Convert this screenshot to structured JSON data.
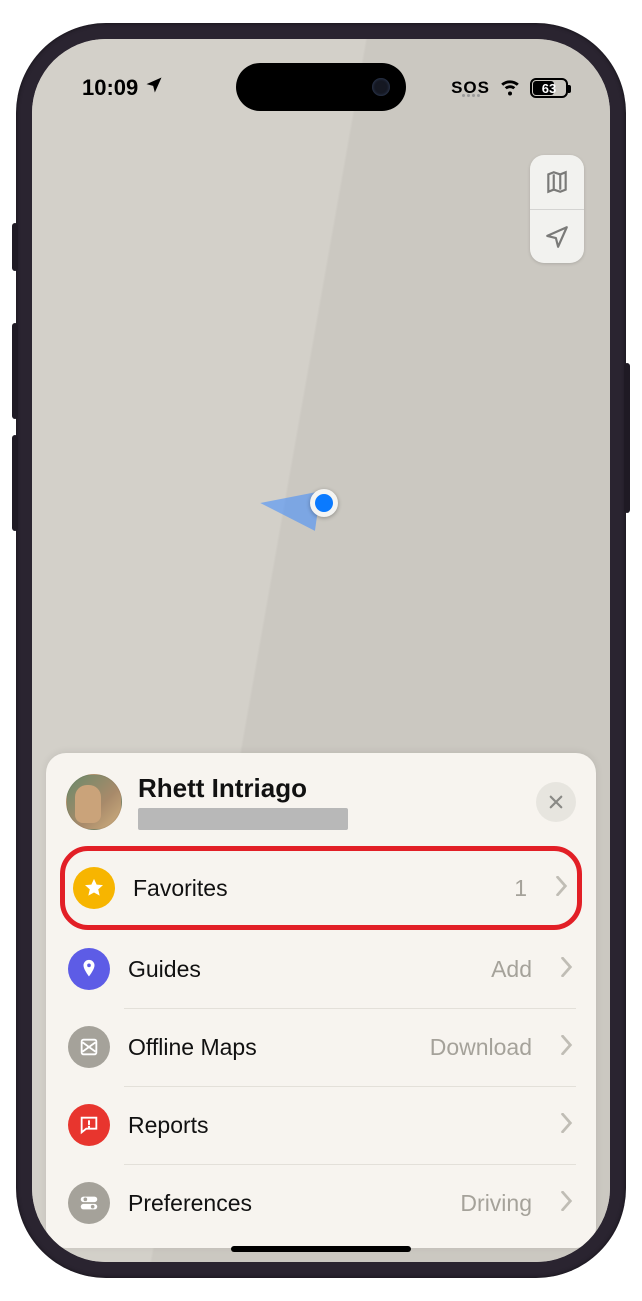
{
  "status": {
    "time": "10:09",
    "sos": "SOS",
    "battery": "63"
  },
  "profile": {
    "name": "Rhett Intriago"
  },
  "items": {
    "favorites": {
      "label": "Favorites",
      "value": "1"
    },
    "guides": {
      "label": "Guides",
      "value": "Add"
    },
    "offline": {
      "label": "Offline Maps",
      "value": "Download"
    },
    "reports": {
      "label": "Reports",
      "value": ""
    },
    "prefs": {
      "label": "Preferences",
      "value": "Driving"
    }
  }
}
